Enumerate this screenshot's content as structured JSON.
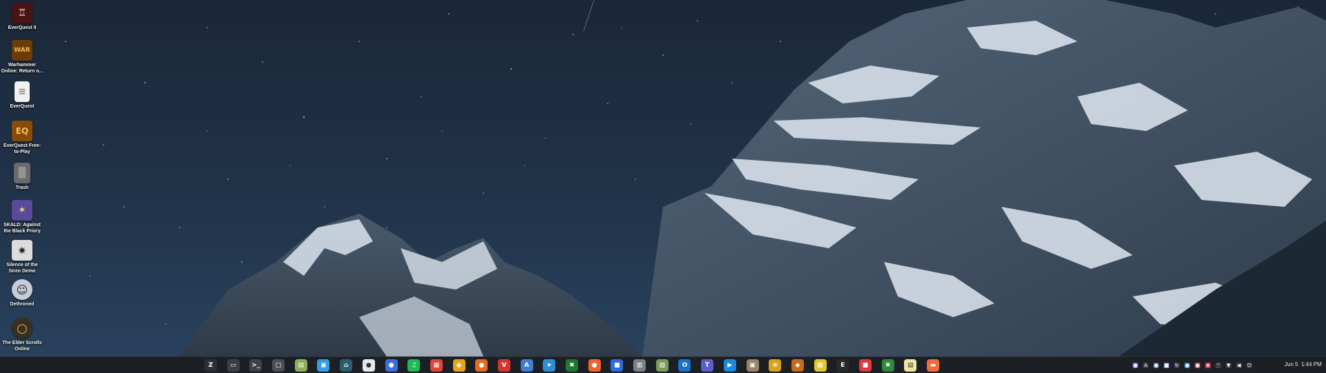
{
  "desktop": {
    "icons": [
      {
        "id": "everquest-ii",
        "label": "EverQuest II",
        "glyph": "♖",
        "color": "#4a1414"
      },
      {
        "id": "warhammer-online",
        "label": "Warhammer Online: Return o...",
        "glyph": "WAR",
        "color": "#6b3b08"
      },
      {
        "id": "everquest",
        "label": "EverQuest",
        "glyph": "≡",
        "color": "#f1f1f1"
      },
      {
        "id": "everquest-free-to-play",
        "label": "EverQuest Free-to-Play",
        "glyph": "EQ",
        "color": "#8a4a08"
      },
      {
        "id": "trash",
        "label": "Trash",
        "glyph": "▒",
        "color": "#6a6a6a"
      },
      {
        "id": "skald",
        "label": "SKALD: Against the Black Priory",
        "glyph": "✶",
        "color": "#5a4a9a"
      },
      {
        "id": "silence-of-the-siren",
        "label": "Silence of the Siren Demo",
        "glyph": "✷",
        "color": "#dcdcdc"
      },
      {
        "id": "dethroned",
        "label": "Dethroned",
        "glyph": "☺",
        "color": "#c8ccd8"
      },
      {
        "id": "elder-scrolls-online",
        "label": "The Elder Scrolls Online",
        "glyph": "○",
        "color": "#3a3020"
      }
    ]
  },
  "taskbar": {
    "apps": [
      {
        "name": "zorin-menu",
        "glyph": "Z",
        "color": "#2c3036"
      },
      {
        "name": "workspaces",
        "glyph": "▭",
        "color": "#3a4048"
      },
      {
        "name": "terminal",
        "glyph": ">_",
        "color": "#3d4249"
      },
      {
        "name": "clipboard",
        "glyph": "□",
        "color": "#4a4f57"
      },
      {
        "name": "files",
        "glyph": "▤",
        "color": "#8fae5a"
      },
      {
        "name": "software-store",
        "glyph": "▣",
        "color": "#2f9fe0"
      },
      {
        "name": "headset",
        "glyph": "⌂",
        "color": "#2c5d6a"
      },
      {
        "name": "chat-app",
        "glyph": "●",
        "color": "#e8e8e8"
      },
      {
        "name": "signal",
        "glyph": "●",
        "color": "#3b6fe0"
      },
      {
        "name": "spotify",
        "glyph": "♫",
        "color": "#1db954"
      },
      {
        "name": "calendar",
        "glyph": "▦",
        "color": "#e0453a"
      },
      {
        "name": "chrome",
        "glyph": "◉",
        "color": "#e8a418"
      },
      {
        "name": "firefox",
        "glyph": "●",
        "color": "#e66a1f"
      },
      {
        "name": "vivaldi",
        "glyph": "V",
        "color": "#d6362f"
      },
      {
        "name": "appimage",
        "glyph": "A",
        "color": "#3a7fd0"
      },
      {
        "name": "telegram",
        "glyph": "➤",
        "color": "#2b8fd6"
      },
      {
        "name": "xbox",
        "glyph": "✖",
        "color": "#1e7a2e"
      },
      {
        "name": "postman",
        "glyph": "●",
        "color": "#f0652c"
      },
      {
        "name": "zoom",
        "glyph": "■",
        "color": "#2d6be0"
      },
      {
        "name": "disks",
        "glyph": "▥",
        "color": "#7a8088"
      },
      {
        "name": "image-viewer",
        "glyph": "▧",
        "color": "#7a9e5a"
      },
      {
        "name": "outlook",
        "glyph": "O",
        "color": "#1a73c8"
      },
      {
        "name": "teams",
        "glyph": "T",
        "color": "#5b5fc7"
      },
      {
        "name": "meet",
        "glyph": "▶",
        "color": "#1a8ae0"
      },
      {
        "name": "archive",
        "glyph": "▣",
        "color": "#9a8466"
      },
      {
        "name": "lutris",
        "glyph": "❀",
        "color": "#d9a21a"
      },
      {
        "name": "heroic",
        "glyph": "◆",
        "color": "#c86a1a"
      },
      {
        "name": "bottles",
        "glyph": "▦",
        "color": "#e0c830"
      },
      {
        "name": "epic",
        "glyph": "E",
        "color": "#2a2a2a"
      },
      {
        "name": "itch",
        "glyph": "■",
        "color": "#e03a3a"
      },
      {
        "name": "xbox-2",
        "glyph": "✖",
        "color": "#2e8a3e"
      },
      {
        "name": "notes",
        "glyph": "▤",
        "color": "#f0e6a0"
      },
      {
        "name": "presentation",
        "glyph": "▬",
        "color": "#f06a3a"
      }
    ],
    "tray": [
      {
        "name": "tray-discord-icon",
        "glyph": "●",
        "color": "#5865f2"
      },
      {
        "name": "tray-a-icon",
        "glyph": "A",
        "color": "#3a3f48"
      },
      {
        "name": "tray-steam-icon",
        "glyph": "●",
        "color": "#4a6a8a"
      },
      {
        "name": "tray-teams-icon",
        "glyph": "■",
        "color": "#6a6fd0"
      },
      {
        "name": "tray-sync-icon",
        "glyph": "↻",
        "color": "#3a3f48"
      },
      {
        "name": "tray-update-icon",
        "glyph": "●",
        "color": "#2a7ad0"
      },
      {
        "name": "tray-record-icon",
        "glyph": "●",
        "color": "#d03a3a"
      },
      {
        "name": "tray-star-icon",
        "glyph": "★",
        "color": "#d03a5a"
      },
      {
        "name": "tray-expand-icon",
        "glyph": "⌃",
        "color": "#3a3f48"
      },
      {
        "name": "tray-wifi-icon",
        "glyph": "▼",
        "color": "#3a3f48"
      },
      {
        "name": "tray-volume-icon",
        "glyph": "◀",
        "color": "#3a3f48"
      },
      {
        "name": "tray-power-icon",
        "glyph": "⏻",
        "color": "#3a3f48"
      }
    ],
    "clock_date": "Jun 5",
    "clock_time": "1:44 PM"
  }
}
